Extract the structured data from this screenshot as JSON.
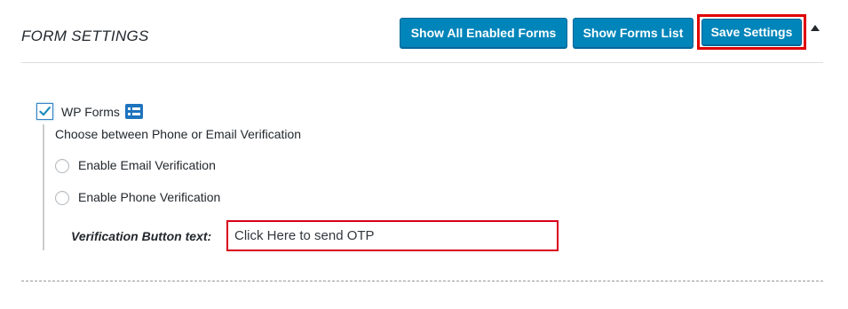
{
  "header": {
    "title": "FORM SETTINGS",
    "buttons": {
      "show_all_enabled": "Show All Enabled Forms",
      "show_forms_list": "Show Forms List",
      "save_settings": "Save Settings"
    },
    "collapse_icon": "triangle-up-icon"
  },
  "form": {
    "name": "WP Forms",
    "checked": true,
    "icon": "form-list-icon",
    "choose_text": "Choose between Phone or Email Verification",
    "options": [
      {
        "label": "Enable Email Verification",
        "selected": false
      },
      {
        "label": "Enable Phone Verification",
        "selected": false
      }
    ],
    "verification_button_label": "Verification Button text:",
    "verification_button_value": "Click Here to send OTP"
  },
  "colors": {
    "primary_button": "#0085ba",
    "highlight": "#e00000"
  }
}
